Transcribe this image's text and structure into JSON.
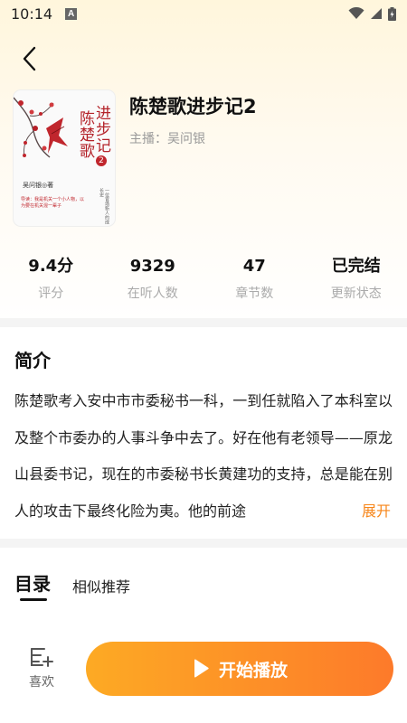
{
  "status_bar": {
    "time": "10:14",
    "notification_glyph": "A",
    "icons": [
      "wifi-icon",
      "signal-icon",
      "battery-icon"
    ]
  },
  "nav": {
    "back_icon": "chevron-left-icon"
  },
  "book": {
    "title": "陈楚歌进步记2",
    "host_label": "主播：吴问银",
    "cover": {
      "title_col_1": "进步记",
      "title_col_2": "陈楚歌",
      "volume_badge": "2",
      "author": "吴问银◎著",
      "tagline": "导读：我是机关一个小人物，以为要在机关混一辈子",
      "side_text": "一位官场新人的成长史"
    }
  },
  "stats": [
    {
      "value": "9.4分",
      "label": "评分"
    },
    {
      "value": "9329",
      "label": "在听人数"
    },
    {
      "value": "47",
      "label": "章节数"
    },
    {
      "value": "已完结",
      "label": "更新状态"
    }
  ],
  "intro": {
    "heading": "简介",
    "text": "陈楚歌考入安中市市委秘书一科，一到任就陷入了本科室以及整个市委办的人事斗争中去了。好在他有老领导——原龙山县委书记，现在的市委秘书长黄建功的支持，总是能在别人的攻击下最终化险为夷。他的前途",
    "expand_label": "展开"
  },
  "tabs": [
    {
      "label": "目录",
      "active": true
    },
    {
      "label": "相似推荐",
      "active": false
    }
  ],
  "bottom_bar": {
    "like_label": "喜欢",
    "like_icon": "add-to-list-icon",
    "play_label": "开始播放",
    "play_icon": "play-icon"
  },
  "colors": {
    "accent": "#f7861a",
    "play_gradient_start": "#fdaa24",
    "play_gradient_end": "#fd7a2a",
    "header_bg": "#fff6dc",
    "muted_text": "#aaaaaa"
  }
}
